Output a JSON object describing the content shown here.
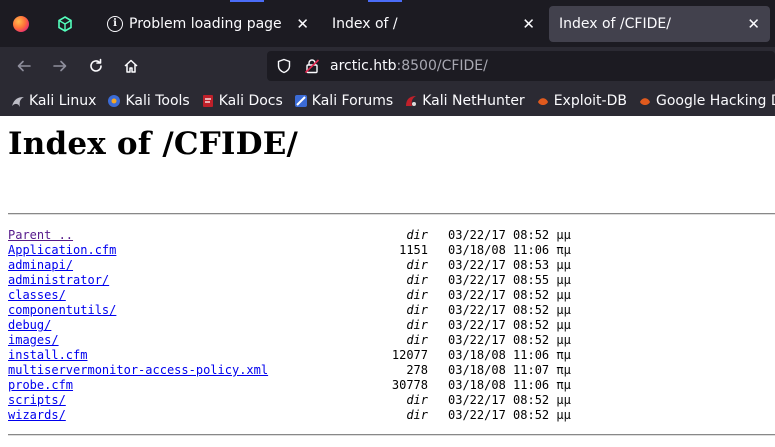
{
  "browser": {
    "tabs": [
      {
        "title": "Problem loading page",
        "icon": "info-icon"
      },
      {
        "title": "Index of /",
        "icon": "none"
      },
      {
        "title": "Index of /CFIDE/",
        "icon": "none",
        "active": true
      }
    ],
    "close_glyph": "✕",
    "url": {
      "host": "arctic.htb",
      "rest": ":8500/CFIDE/"
    },
    "bookmarks": [
      {
        "label": "Kali Linux",
        "color": "#5a5a5a"
      },
      {
        "label": "Kali Tools",
        "color": "#3b6bd6"
      },
      {
        "label": "Kali Docs",
        "color": "#c0202a"
      },
      {
        "label": "Kali Forums",
        "color": "#3b6bd6"
      },
      {
        "label": "Kali NetHunter",
        "color": "#c0202a"
      },
      {
        "label": "Exploit-DB",
        "color": "#e05a1e"
      },
      {
        "label": "Google Hacking DB",
        "color": "#e05a1e"
      }
    ]
  },
  "page": {
    "title": "Index of /CFIDE/",
    "entries": [
      {
        "name": "Parent ..",
        "size": "dir",
        "date": "03/22/17 08:52 μμ",
        "visited": true
      },
      {
        "name": "Application.cfm",
        "size": "1151",
        "date": "03/18/08 11:06 πμ"
      },
      {
        "name": "adminapi/",
        "size": "dir",
        "date": "03/22/17 08:53 μμ"
      },
      {
        "name": "administrator/",
        "size": "dir",
        "date": "03/22/17 08:55 μμ"
      },
      {
        "name": "classes/",
        "size": "dir",
        "date": "03/22/17 08:52 μμ"
      },
      {
        "name": "componentutils/",
        "size": "dir",
        "date": "03/22/17 08:52 μμ"
      },
      {
        "name": "debug/",
        "size": "dir",
        "date": "03/22/17 08:52 μμ"
      },
      {
        "name": "images/",
        "size": "dir",
        "date": "03/22/17 08:52 μμ"
      },
      {
        "name": "install.cfm",
        "size": "12077",
        "date": "03/18/08 11:06 πμ"
      },
      {
        "name": "multiservermonitor-access-policy.xml",
        "size": "278",
        "date": "03/18/08 11:07 πμ"
      },
      {
        "name": "probe.cfm",
        "size": "30778",
        "date": "03/18/08 11:06 πμ"
      },
      {
        "name": "scripts/",
        "size": "dir",
        "date": "03/22/17 08:52 μμ"
      },
      {
        "name": "wizards/",
        "size": "dir",
        "date": "03/22/17 08:52 μμ"
      }
    ]
  }
}
